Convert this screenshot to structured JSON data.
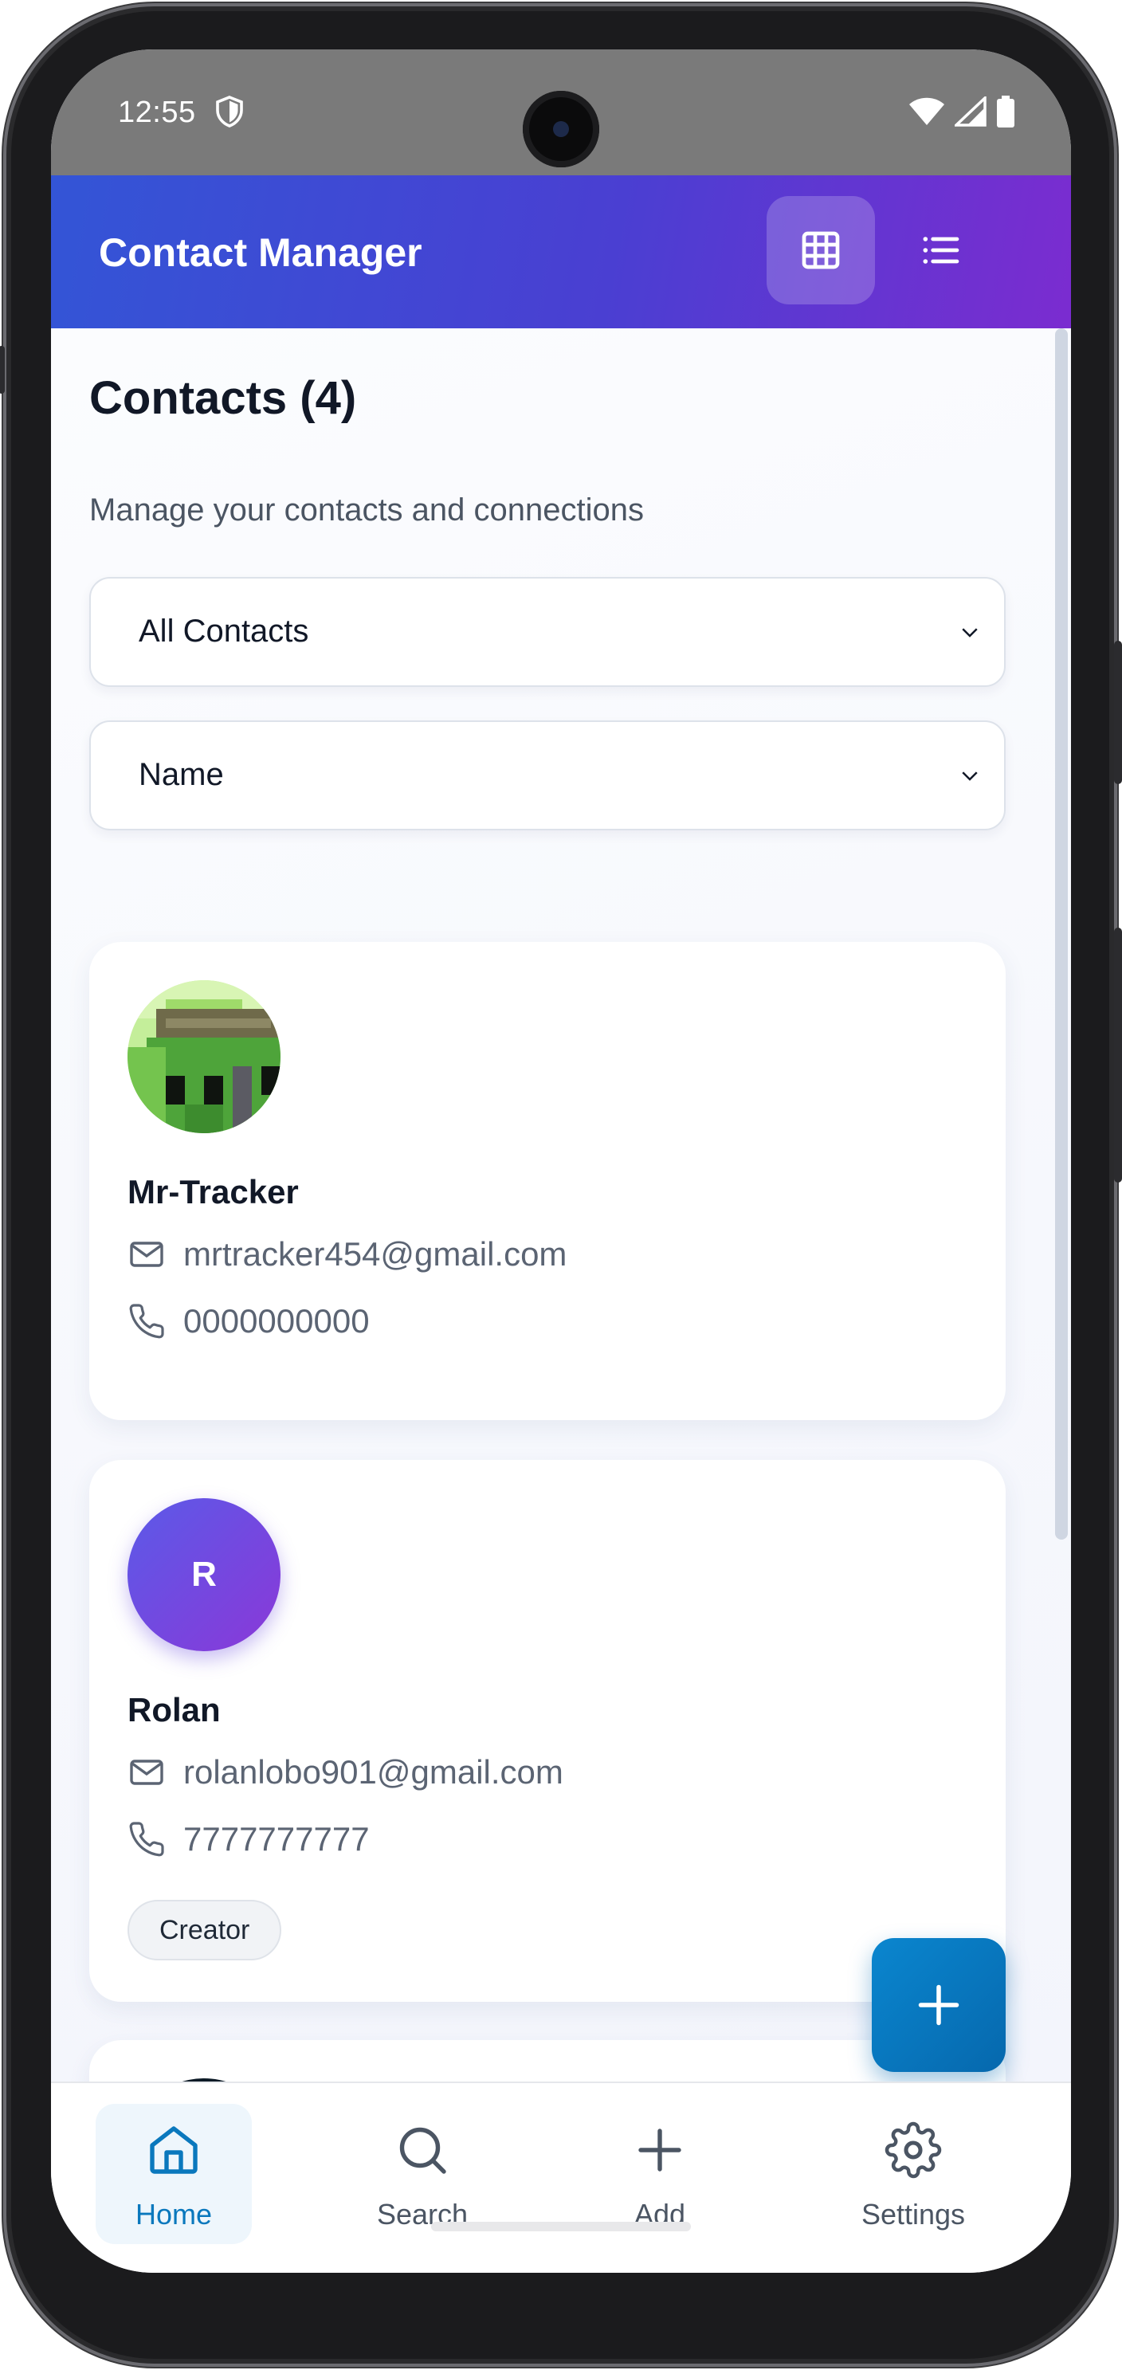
{
  "status_bar": {
    "time": "12:55"
  },
  "app_bar": {
    "title": "Contact Manager"
  },
  "page": {
    "title": "Contacts (4)",
    "subtitle": "Manage your contacts and connections"
  },
  "filters": {
    "group_select": {
      "selected": "All Contacts"
    },
    "sort_select": {
      "selected": "Name"
    }
  },
  "contacts": [
    {
      "name": "Mr-Tracker",
      "email": "mrtracker454@gmail.com",
      "phone": "0000000000",
      "avatar": "pixel-art-image"
    },
    {
      "name": "Rolan",
      "initial": "R",
      "email": "rolanlobo901@gmail.com",
      "phone": "7777777777",
      "tag": "Creator"
    },
    {
      "avatar": "dark-blue-image"
    }
  ],
  "bottom_nav": {
    "items": [
      {
        "label": "Home",
        "icon": "home-icon",
        "active": true
      },
      {
        "label": "Search",
        "icon": "search-icon"
      },
      {
        "label": "Add",
        "icon": "plus-icon"
      },
      {
        "label": "Settings",
        "icon": "gear-icon"
      }
    ]
  },
  "colors": {
    "app_bar_gradient": [
      "#3355d6",
      "#7b2cd0"
    ],
    "accent": "#0a78bd",
    "avatar_gradient": [
      "#5b5ae8",
      "#8a38d8"
    ]
  }
}
